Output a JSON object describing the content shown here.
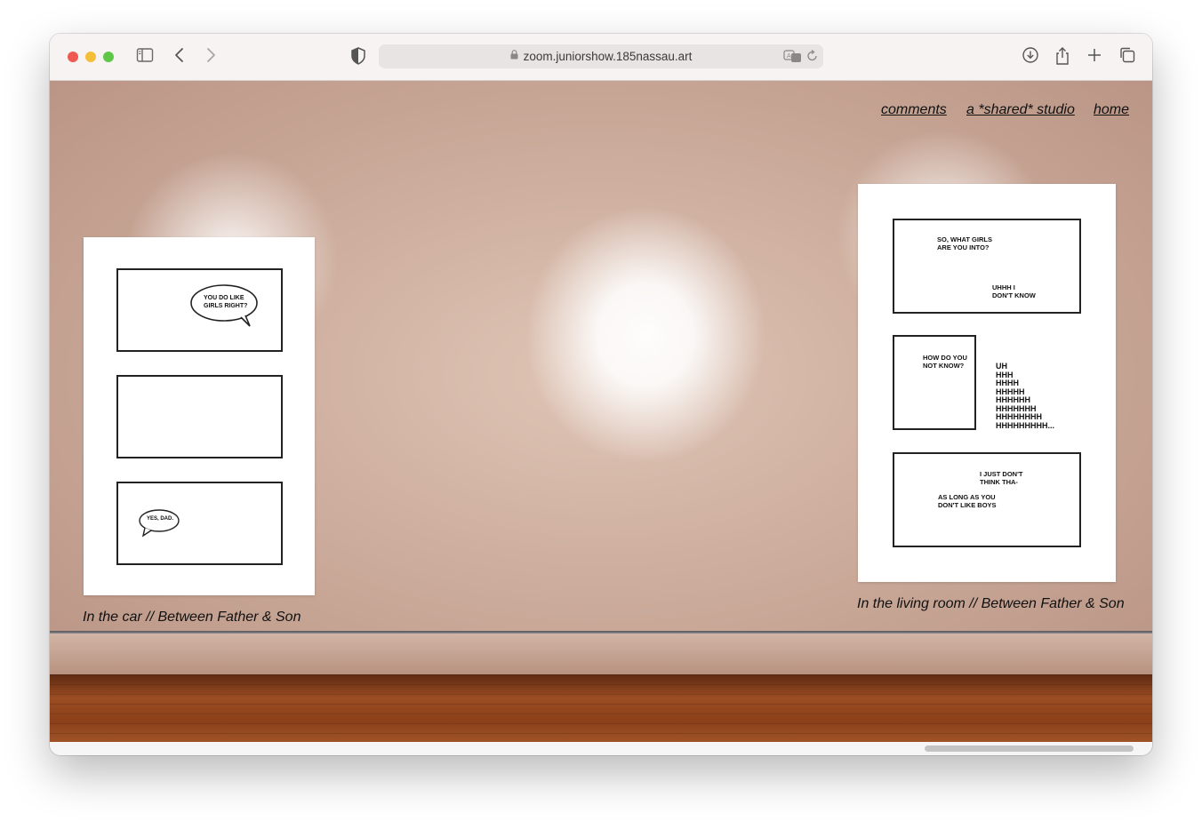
{
  "browser": {
    "url": "zoom.juniorshow.185nassau.art",
    "icons": {
      "sidebar": "sidebar-icon",
      "back": "chevron-left-icon",
      "forward": "chevron-right-icon",
      "shield": "shield-icon",
      "lock": "lock-icon",
      "translate": "translate-icon",
      "reload": "reload-icon",
      "download": "download-icon",
      "share": "share-icon",
      "new_tab": "plus-icon",
      "tabs": "tab-overview-icon"
    }
  },
  "nav": {
    "comments": "comments",
    "shared_studio": "a *shared* studio",
    "home": "home"
  },
  "artworks": {
    "left": {
      "caption": "In the car // Between Father & Son",
      "bubble_1": "You do like\ngirls right?",
      "bubble_2": "Yes, dad."
    },
    "right": {
      "caption": "In the living room // Between Father & Son",
      "p1_line_1": "So, what girls\nare you into?",
      "p1_line_2": "Uhhh I\ndon't know",
      "p2_line_1": "How do you\nnot know?",
      "p2_line_2": "UH\nHHH\nHHHH\nHHHHH\nHHHHHH\nHHHHHHH\nHHHHHHHH\nHHHHHHHHH...",
      "p3_line_1": "I just don't\nthink tha-",
      "p3_line_2": "As long as you\ndon't like boys"
    }
  },
  "colors": {
    "wall": "#c9a898",
    "floor": "#8b4019",
    "nav_text": "#111111"
  }
}
